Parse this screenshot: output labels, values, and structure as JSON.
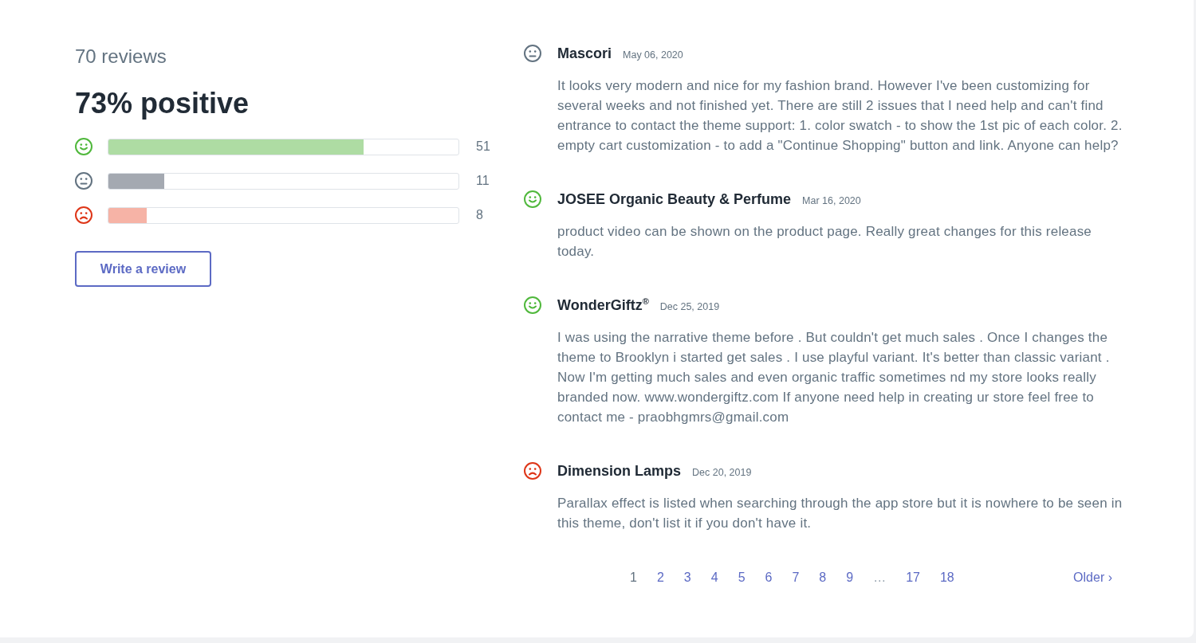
{
  "summary": {
    "review_count": "70 reviews",
    "headline": "73% positive",
    "ratings": [
      {
        "kind": "positive",
        "level": 0.73,
        "count": "51"
      },
      {
        "kind": "neutral",
        "level": 0.16,
        "count": "11"
      },
      {
        "kind": "negative",
        "level": 0.11,
        "count": "8"
      }
    ],
    "write_button": "Write a review"
  },
  "reviews": [
    {
      "kind": "neutral",
      "author": "Mascori",
      "date": "May 06, 2020",
      "text": "It looks very modern and nice for my fashion brand. However I've been customizing for several weeks and not finished yet. There are still 2 issues that I need help and can't find entrance to contact the theme support: 1. color swatch - to show the 1st pic of each color. 2. empty cart customization - to add a \"Continue Shopping\" button and link. Anyone can help?"
    },
    {
      "kind": "positive",
      "author": "JOSEE Organic Beauty & Perfume",
      "date": "Mar 16, 2020",
      "text": "product video can be shown on the product page. Really great changes for this release today."
    },
    {
      "kind": "positive",
      "author": "WonderGiftz$^{®}$",
      "date": "Dec 25, 2019",
      "text": "I was using the narrative theme before . But couldn't get much sales . Once I changes the theme to Brooklyn i started get sales . I use playful variant. It's better than classic variant . Now I'm getting much sales and even organic traffic sometimes nd my store looks really branded now. www.wondergiftz.com If anyone need help in creating ur store feel free to contact me - praobhgmrs@gmail.com"
    },
    {
      "kind": "negative",
      "author": "Dimension Lamps",
      "date": "Dec 20, 2019",
      "text": "Parallax effect is listed when searching through the app store but it is nowhere to be seen in this theme, don't list it if you don't have it."
    }
  ],
  "pagination": {
    "pages": [
      {
        "kind": "page",
        "label": "1",
        "selected": true
      },
      {
        "kind": "page",
        "label": "2",
        "selected": false
      },
      {
        "kind": "page",
        "label": "3",
        "selected": false
      },
      {
        "kind": "page",
        "label": "4",
        "selected": false
      },
      {
        "kind": "page",
        "label": "5",
        "selected": false
      },
      {
        "kind": "page",
        "label": "6",
        "selected": false
      },
      {
        "kind": "page",
        "label": "7",
        "selected": false
      },
      {
        "kind": "page",
        "label": "8",
        "selected": false
      },
      {
        "kind": "page",
        "label": "9",
        "selected": false
      },
      {
        "kind": "ellipsis",
        "label": "…"
      },
      {
        "kind": "page",
        "label": "17",
        "selected": false
      },
      {
        "kind": "page",
        "label": "18",
        "selected": false
      }
    ],
    "next": "Older ›"
  }
}
